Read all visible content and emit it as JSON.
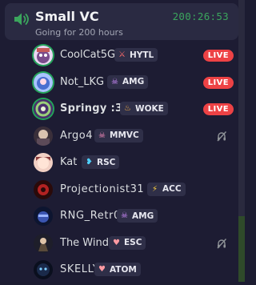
{
  "channel": {
    "name": "Small VC",
    "timer": "200:26:53",
    "subtitle": "Going for 200 hours",
    "icon": "speaker-icon"
  },
  "members": [
    {
      "name": "CoolCat5G",
      "tag": "HYTL",
      "tag_icon": "sword-glyph",
      "tag_color": "#ff6b6b",
      "live": "LIVE",
      "status_icon": "",
      "avatar_color": "#c9a0dc"
    },
    {
      "name": "Not_LKG",
      "tag": "AMG",
      "tag_icon": "skull-glyph",
      "tag_color": "#d08bff",
      "live": "LIVE",
      "status_icon": "",
      "avatar_color": "#8aa9ff"
    },
    {
      "name": "Springy :3",
      "tag": "WOKE",
      "tag_icon": "flame-glyph",
      "tag_color": "#ffb347",
      "live": "LIVE",
      "status_icon": "",
      "avatar_color": "#9bd07a"
    },
    {
      "name": "Argo4",
      "tag": "MMVC",
      "tag_icon": "skull-glyph",
      "tag_color": "#ff8fc0",
      "live": "",
      "status_icon": "deafened-icon",
      "avatar_color": "#8b6f6f"
    },
    {
      "name": "Kat",
      "tag": "RSC",
      "tag_icon": "leaf-glyph",
      "tag_color": "#4fd1ff",
      "live": "",
      "status_icon": "",
      "avatar_color": "#c47a7a"
    },
    {
      "name": "Projectionist31",
      "tag": "ACC",
      "tag_icon": "bolt-glyph",
      "tag_color": "#ffd23f",
      "live": "",
      "status_icon": "",
      "avatar_color": "#b22222"
    },
    {
      "name": "RNG_Retr0",
      "tag": "AMG",
      "tag_icon": "skull-glyph",
      "tag_color": "#d08bff",
      "live": "",
      "status_icon": "",
      "avatar_color": "#3b55b0"
    },
    {
      "name": "The Wind",
      "tag": "ESC",
      "tag_icon": "heart-glyph",
      "tag_color": "#ff9aa2",
      "live": "",
      "status_icon": "deafened-icon",
      "avatar_color": "#5a4a3a"
    },
    {
      "name": "SKELLY",
      "tag": "ATOM",
      "tag_icon": "heart-glyph",
      "tag_color": "#ff9aa2",
      "live": "",
      "status_icon": "",
      "avatar_color": "#1a2a4a"
    }
  ],
  "colors": {
    "background": "#1d1c33",
    "card": "#2a2a42",
    "timer": "#3ba55d",
    "live": "#ed4245"
  }
}
